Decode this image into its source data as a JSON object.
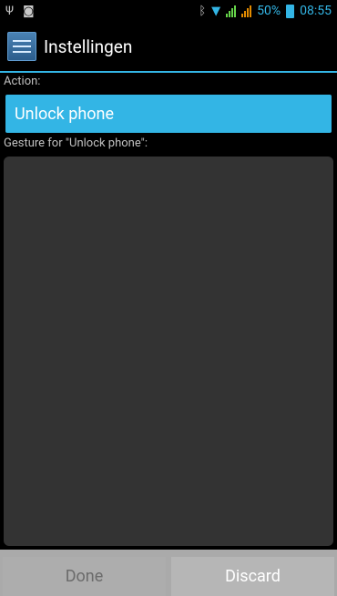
{
  "status_bar": {
    "left_icons": [
      "usb-icon",
      "android-icon"
    ],
    "battery_percent": "50%",
    "time": "08:55",
    "right_icons": [
      "bluetooth-icon",
      "wifi-icon",
      "signal-icon",
      "signal-icon",
      "battery-icon"
    ]
  },
  "action_bar": {
    "icon": "settings-app-icon",
    "title": "Instellingen"
  },
  "form": {
    "action_label": "Action:",
    "action_value": "Unlock phone",
    "gesture_label": "Gesture for \"Unlock phone\":"
  },
  "buttons": {
    "done": "Done",
    "discard": "Discard"
  },
  "colors": {
    "accent": "#33b5e5",
    "background": "#000000",
    "gesture_pad": "#333333",
    "button_bar": "#aaaaaa"
  }
}
